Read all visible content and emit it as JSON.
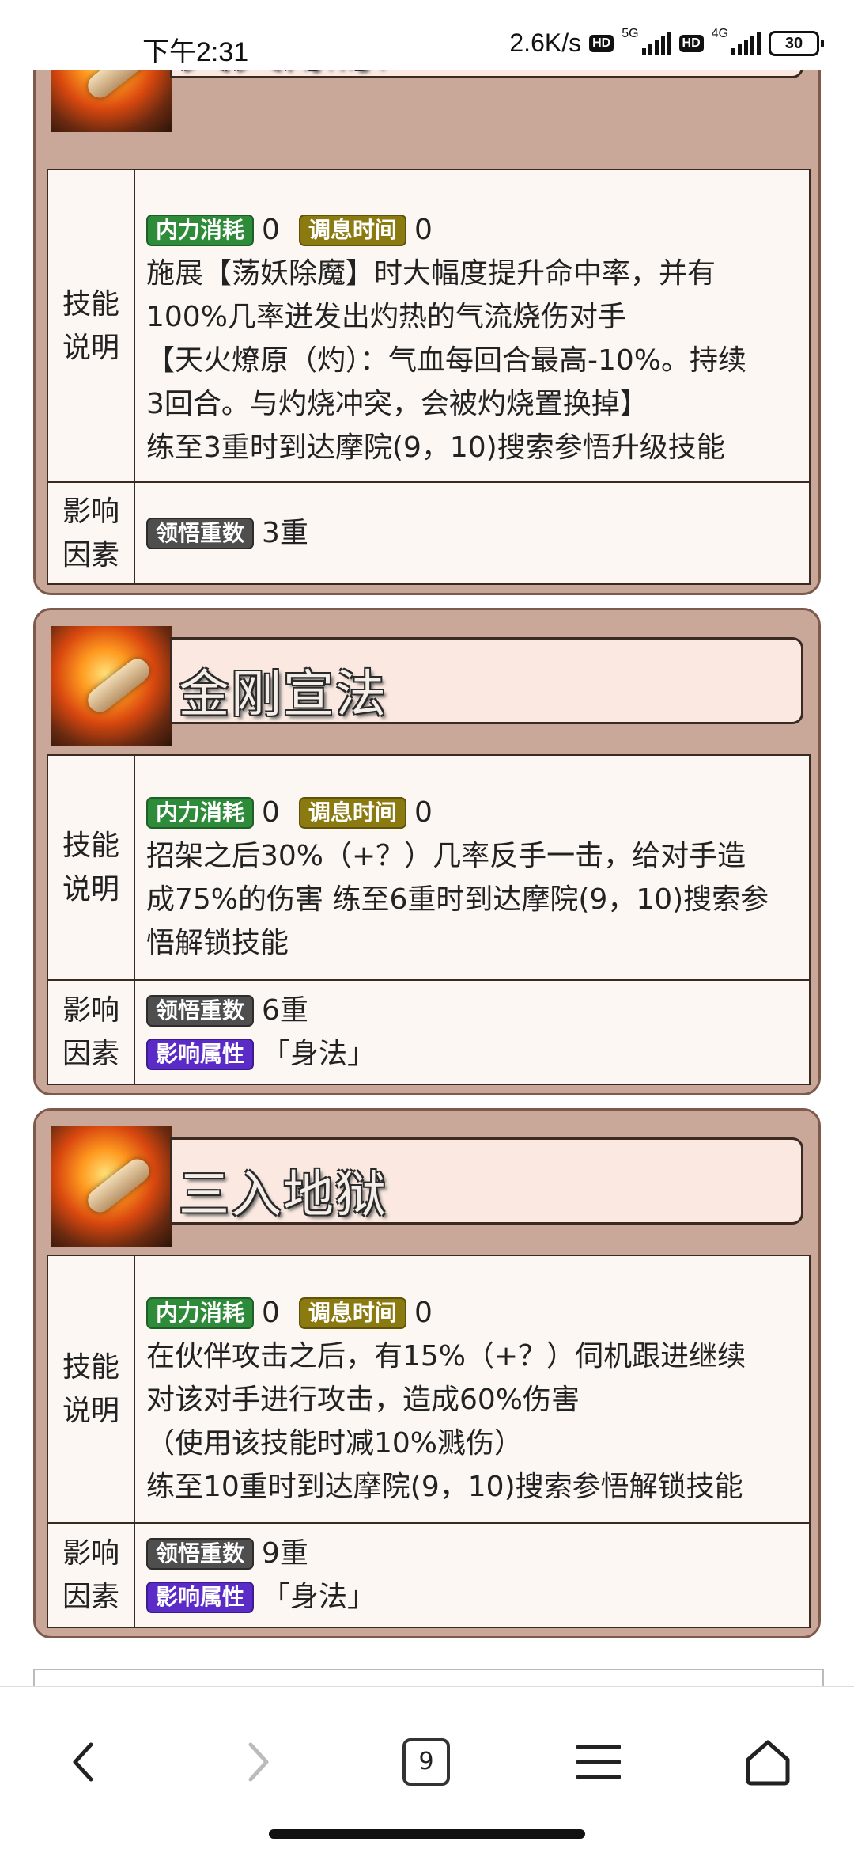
{
  "status_bar": {
    "time": "下午2:31",
    "speed": "2.6K/s",
    "hd": "HD",
    "net1": "5G",
    "net2": "4G",
    "battery": "30"
  },
  "skills": [
    {
      "name": "天火燎原",
      "desc_label": [
        "技能",
        "说明"
      ],
      "tags": {
        "neili": "内力消耗",
        "neili_val": "0",
        "tiaoxi": "调息时间",
        "tiaoxi_val": "0"
      },
      "desc_lines": [
        "施展【荡妖除魔】时大幅度提升命中率，并有",
        "100%几率迸发出灼热的气流烧伤对手",
        "【天火燎原（灼）：气血每回合最高-10%。持续",
        "3回合。与灼烧冲突，会被灼烧置换掉】",
        "练至3重时到达摩院(9，10)搜索参悟升级技能"
      ],
      "effect_label": [
        "影响",
        "因素"
      ],
      "effects": [
        {
          "tag": "领悟重数",
          "value": "3重",
          "color": "gray"
        }
      ]
    },
    {
      "name": "金刚宣法",
      "desc_label": [
        "技能",
        "说明"
      ],
      "tags": {
        "neili": "内力消耗",
        "neili_val": "0",
        "tiaoxi": "调息时间",
        "tiaoxi_val": "0"
      },
      "desc_lines": [
        "招架之后30%（+？）几率反手一击，给对手造",
        "成75%的伤害 练至6重时到达摩院(9，10)搜索参",
        "悟解锁技能"
      ],
      "effect_label": [
        "影响",
        "因素"
      ],
      "effects": [
        {
          "tag": "领悟重数",
          "value": "6重",
          "color": "gray"
        },
        {
          "tag": "影响属性",
          "value": "「身法」",
          "color": "purple"
        }
      ]
    },
    {
      "name": "三入地狱",
      "desc_label": [
        "技能",
        "说明"
      ],
      "tags": {
        "neili": "内力消耗",
        "neili_val": "0",
        "tiaoxi": "调息时间",
        "tiaoxi_val": "0"
      },
      "desc_lines": [
        "在伙伴攻击之后，有15%（+？）伺机跟进继续",
        "对该对手进行攻击，造成60%伤害",
        "（使用该技能时减10%溅伤）",
        "练至10重时到达摩院(9，10)搜索参悟解锁技能"
      ],
      "effect_label": [
        "影响",
        "因素"
      ],
      "effects": [
        {
          "tag": "领悟重数",
          "value": "9重",
          "color": "gray"
        },
        {
          "tag": "影响属性",
          "value": "「身法」",
          "color": "purple"
        }
      ]
    }
  ],
  "nav": {
    "back_icon": "chevron-left-icon",
    "forward_icon": "chevron-right-icon",
    "tab_count": "9",
    "menu_icon": "hamburger-icon",
    "home_icon": "home-icon"
  }
}
